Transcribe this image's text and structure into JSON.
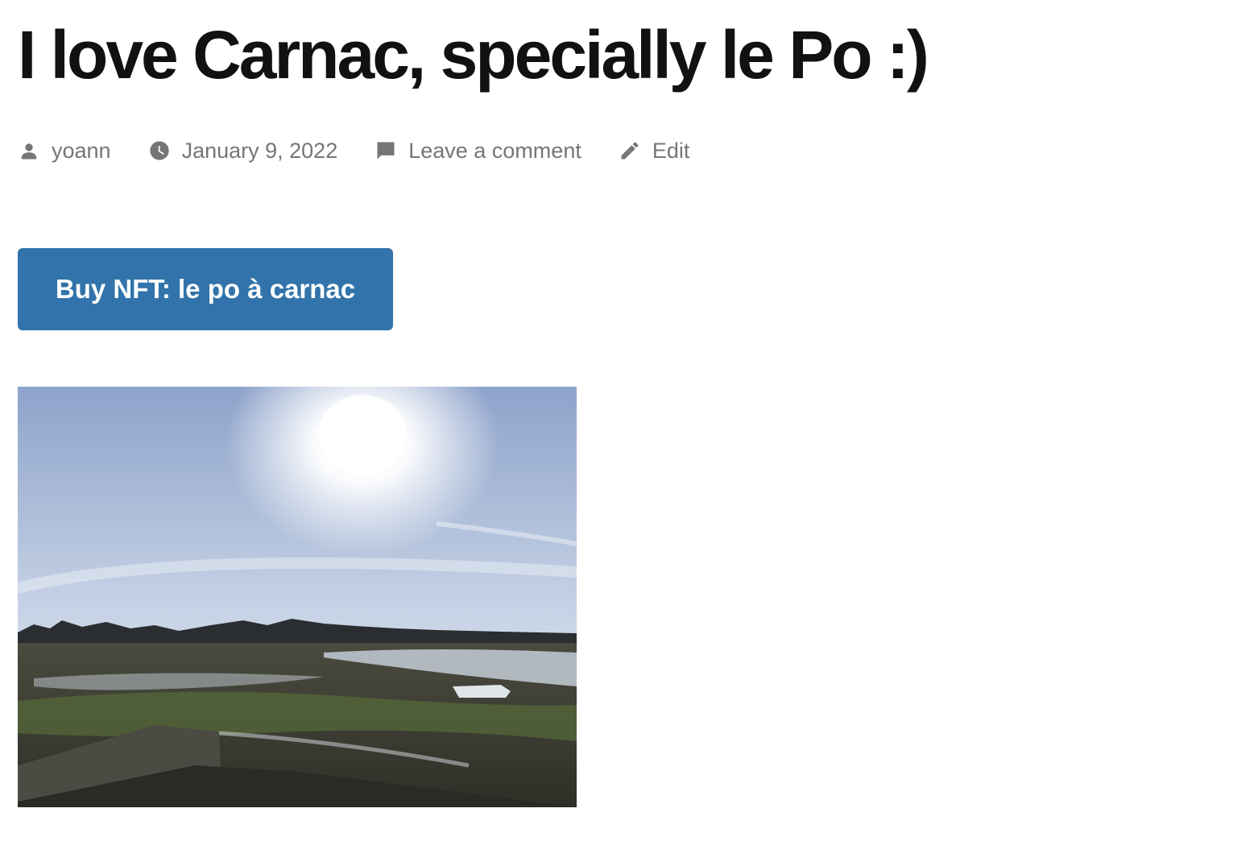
{
  "post": {
    "title": "I love Carnac, specially le Po :)",
    "meta": {
      "author": "yoann",
      "date": "January 9, 2022",
      "comment_link": "Leave a comment",
      "edit_link": "Edit"
    },
    "nft_button_label": "Buy NFT: le po à carnac",
    "image": {
      "subject": "tidal flats at Carnac under a bright hazy sky with the sun, village on the horizon, boat on the mud",
      "sky_top": "#8ea3cb",
      "sky_light": "#e9eef5",
      "ground_dark": "#2e2f27",
      "grass": "#56683a",
      "water": "#c4cdd6"
    }
  },
  "icons": {
    "author": "person-icon",
    "date": "clock-icon",
    "comment": "comment-bubble-icon",
    "edit": "pencil-icon"
  },
  "colors": {
    "title": "#111111",
    "meta_text": "#767676",
    "button_bg": "#3173aa",
    "button_text": "#ffffff",
    "page_bg": "#ffffff"
  }
}
